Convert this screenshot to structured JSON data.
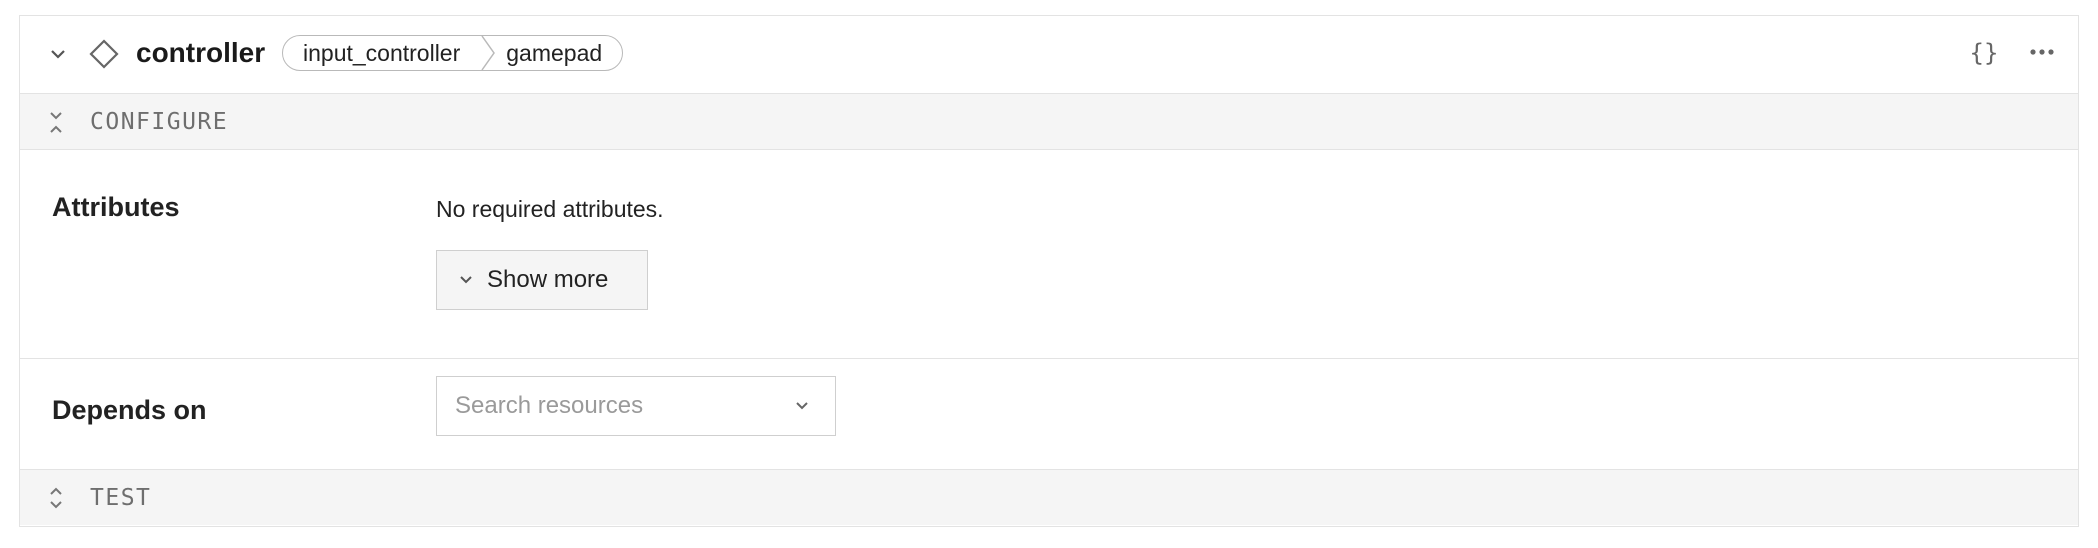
{
  "header": {
    "title": "controller",
    "breadcrumb": [
      "input_controller",
      "gamepad"
    ],
    "icons": [
      "chevron-down-icon",
      "diamond-icon",
      "json-braces-icon",
      "more-icon"
    ]
  },
  "configure": {
    "label": "CONFIGURE"
  },
  "attributes": {
    "label": "Attributes",
    "empty_text": "No required attributes.",
    "show_more_label": "Show more"
  },
  "depends_on": {
    "label": "Depends on",
    "placeholder": "Search resources"
  },
  "test": {
    "label": "TEST"
  },
  "colors": {
    "border": "#e3e3e3",
    "bar_bg": "#f5f5f5",
    "muted": "#6e6e6e"
  }
}
